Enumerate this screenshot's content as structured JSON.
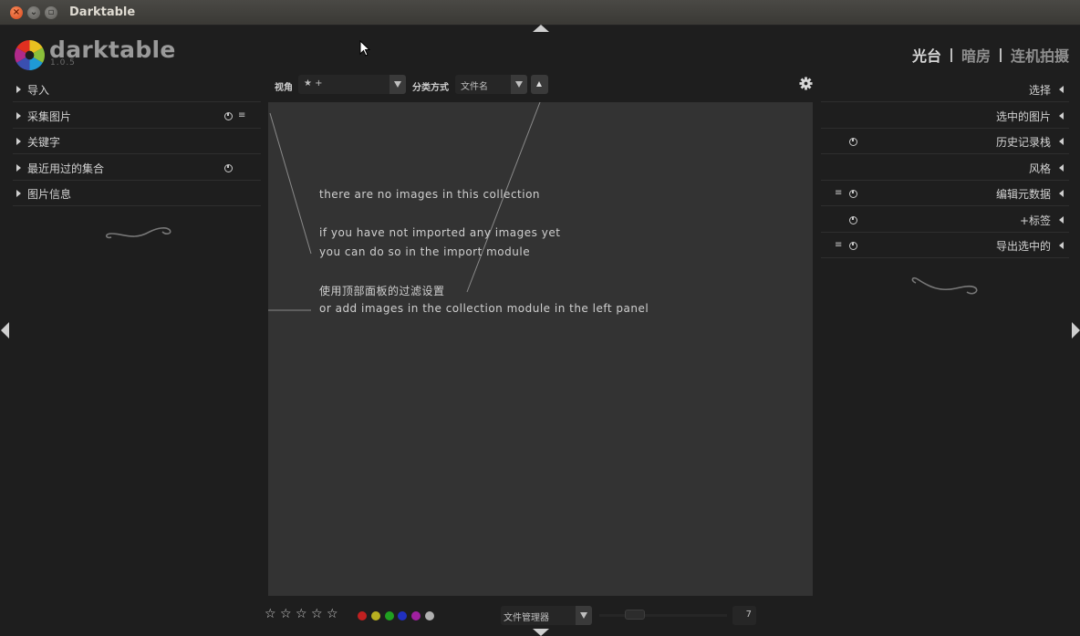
{
  "window": {
    "title": "Darktable",
    "buttons": {
      "close": "×",
      "minimize": "⌄",
      "maximize": "▫"
    }
  },
  "logo": {
    "name": "darktable",
    "version": "1.0.5"
  },
  "views": [
    {
      "label": "光台",
      "active": true
    },
    {
      "label": "暗房",
      "active": false
    },
    {
      "label": "连机拍摄",
      "active": false
    }
  ],
  "left_panel": {
    "modules": [
      {
        "label": "导入"
      },
      {
        "label": "采集图片",
        "icons": [
          "reset-icon",
          "presets-icon"
        ]
      },
      {
        "label": "关键字"
      },
      {
        "label": "最近用过的集合",
        "icons": [
          "reset-icon"
        ]
      },
      {
        "label": "图片信息"
      }
    ]
  },
  "right_panel": {
    "modules": [
      {
        "label": "选择"
      },
      {
        "label": "选中的图片"
      },
      {
        "label": "历史记录栈",
        "icons": [
          "reset-icon"
        ]
      },
      {
        "label": "风格"
      },
      {
        "label": "编辑元数据",
        "icons": [
          "presets-icon",
          "reset-icon"
        ]
      },
      {
        "label": "+标签",
        "icons": [
          "reset-icon"
        ]
      },
      {
        "label": "导出选中的",
        "icons": [
          "presets-icon",
          "reset-icon"
        ]
      }
    ]
  },
  "filterbar": {
    "view_label": "视角",
    "view_value": "★ +",
    "sort_label": "分类方式",
    "sort_value": "文件名"
  },
  "center_message": {
    "line1": "there are no images in this collection",
    "line2": "if you have not imported any images yet",
    "line3": "you can do so in the import module",
    "line4": "使用顶部面板的过滤设置",
    "line5": "or add images in the collection module in the left panel"
  },
  "bottombar": {
    "stars": [
      "☆",
      "☆",
      "☆",
      "☆",
      "☆"
    ],
    "color_labels": [
      "#c02020",
      "#b8b020",
      "#20a020",
      "#2030c0",
      "#a020a0",
      "#b0b0b0"
    ],
    "layout_value": "文件管理器",
    "zoom_value": "7"
  },
  "colors": {
    "background": "#1e1e1e",
    "center": "#333333",
    "text": "#d2d2d2"
  }
}
